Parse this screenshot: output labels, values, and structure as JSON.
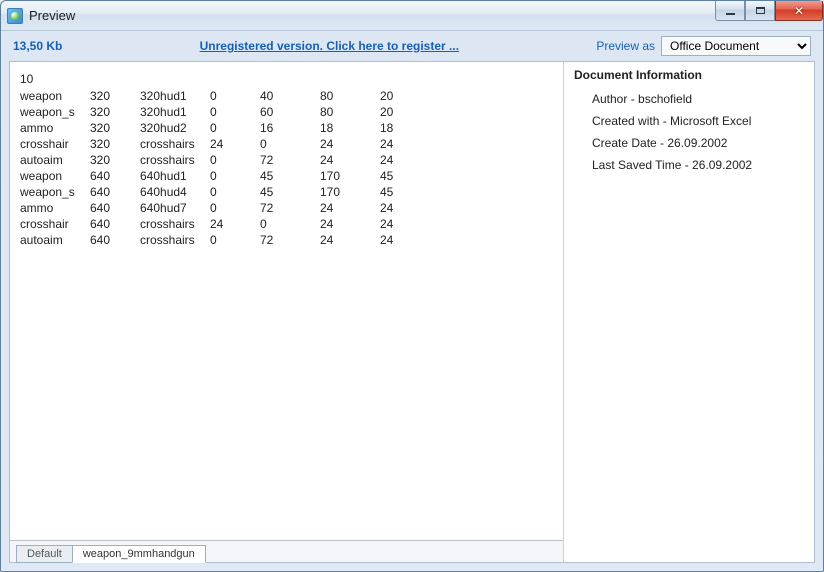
{
  "window": {
    "title": "Preview"
  },
  "status": {
    "size": "13,50 Kb",
    "register": "Unregistered version. Click here to register ...",
    "preview_as_label": "Preview as",
    "preview_as_value": "Office Document"
  },
  "grid": {
    "head": "10",
    "rows": [
      {
        "c0": "weapon",
        "c1": "320",
        "c2": "320hud1",
        "c3": "0",
        "c4": "40",
        "c5": "80",
        "c6": "20"
      },
      {
        "c0": "weapon_s",
        "c1": "320",
        "c2": "320hud1",
        "c3": "0",
        "c4": "60",
        "c5": "80",
        "c6": "20"
      },
      {
        "c0": "ammo",
        "c1": "320",
        "c2": "320hud2",
        "c3": "0",
        "c4": "16",
        "c5": "18",
        "c6": "18"
      },
      {
        "c0": "crosshair",
        "c1": "320",
        "c2": "crosshairs",
        "c3": "24",
        "c4": "0",
        "c5": "24",
        "c6": "24"
      },
      {
        "c0": "autoaim",
        "c1": "320",
        "c2": "crosshairs",
        "c3": "0",
        "c4": "72",
        "c5": "24",
        "c6": "24"
      },
      {
        "c0": "weapon",
        "c1": "640",
        "c2": "640hud1",
        "c3": "0",
        "c4": "45",
        "c5": "170",
        "c6": "45"
      },
      {
        "c0": "weapon_s",
        "c1": "640",
        "c2": "640hud4",
        "c3": "0",
        "c4": "45",
        "c5": "170",
        "c6": "45"
      },
      {
        "c0": "ammo",
        "c1": "640",
        "c2": "640hud7",
        "c3": "0",
        "c4": "72",
        "c5": "24",
        "c6": "24"
      },
      {
        "c0": "crosshair",
        "c1": "640",
        "c2": "crosshairs",
        "c3": "24",
        "c4": "0",
        "c5": "24",
        "c6": "24"
      },
      {
        "c0": "autoaim",
        "c1": "640",
        "c2": "crosshairs",
        "c3": "0",
        "c4": "72",
        "c5": "24",
        "c6": "24"
      }
    ]
  },
  "sheets": {
    "tabs": [
      {
        "label": "Default",
        "active": false
      },
      {
        "label": "weapon_9mmhandgun",
        "active": true
      }
    ]
  },
  "info": {
    "header": "Document Information",
    "items": [
      "Author - bschofield",
      "Created with - Microsoft Excel",
      "Create Date - 26.09.2002",
      "Last Saved Time - 26.09.2002"
    ]
  }
}
